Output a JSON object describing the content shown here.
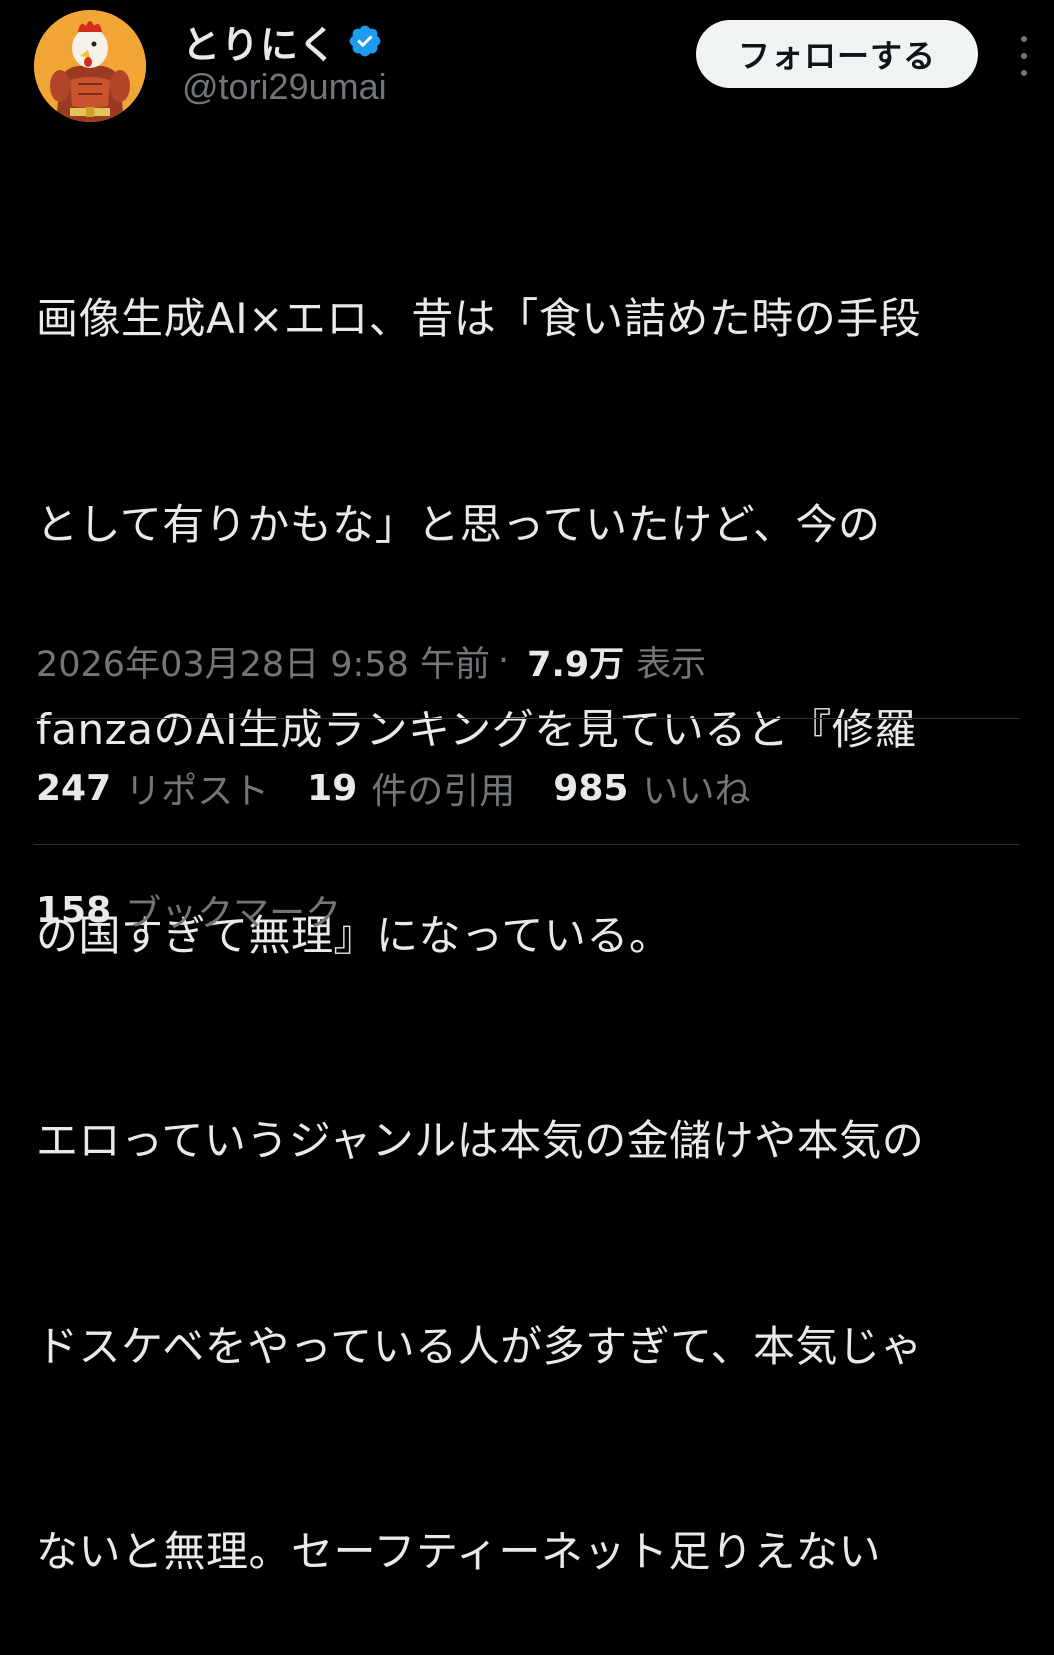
{
  "author": {
    "display_name": "とりにく",
    "handle": "@tori29umai",
    "verified": true,
    "avatar_icon": "rooster-warrior-avatar-icon"
  },
  "actions": {
    "follow_label": "フォローする",
    "more_icon": "more-vertical-icon"
  },
  "tweet": {
    "lines": [
      "画像生成AI×エロ、昔は「食い詰めた時の手段",
      "として有りかもな」と思っていたけど、今の",
      "fanzaのAI生成ランキングを見ていると『修羅",
      "の国すぎて無理』になっている。",
      "エロっていうジャンルは本気の金儲けや本気の",
      "ドスケベをやっている人が多すぎて、本気じゃ",
      "ないと無理。セーフティーネット足りえない"
    ],
    "timestamp": "2026年03月28日 9:58 午前",
    "separator": "·",
    "views_count": "7.9万",
    "views_label": "表示"
  },
  "stats": {
    "reposts_count": "247",
    "reposts_label": "リポスト",
    "quotes_count": "19",
    "quotes_label": "件の引用",
    "likes_count": "985",
    "likes_label": "いいね",
    "bookmarks_count": "158",
    "bookmarks_label": "ブックマーク"
  },
  "colors": {
    "background": "#000000",
    "primary_text": "#e7e9ea",
    "secondary_text": "#71767b",
    "divider": "#2f3336",
    "verified_blue": "#1d9bf0",
    "follow_bg": "#eff3f4"
  }
}
